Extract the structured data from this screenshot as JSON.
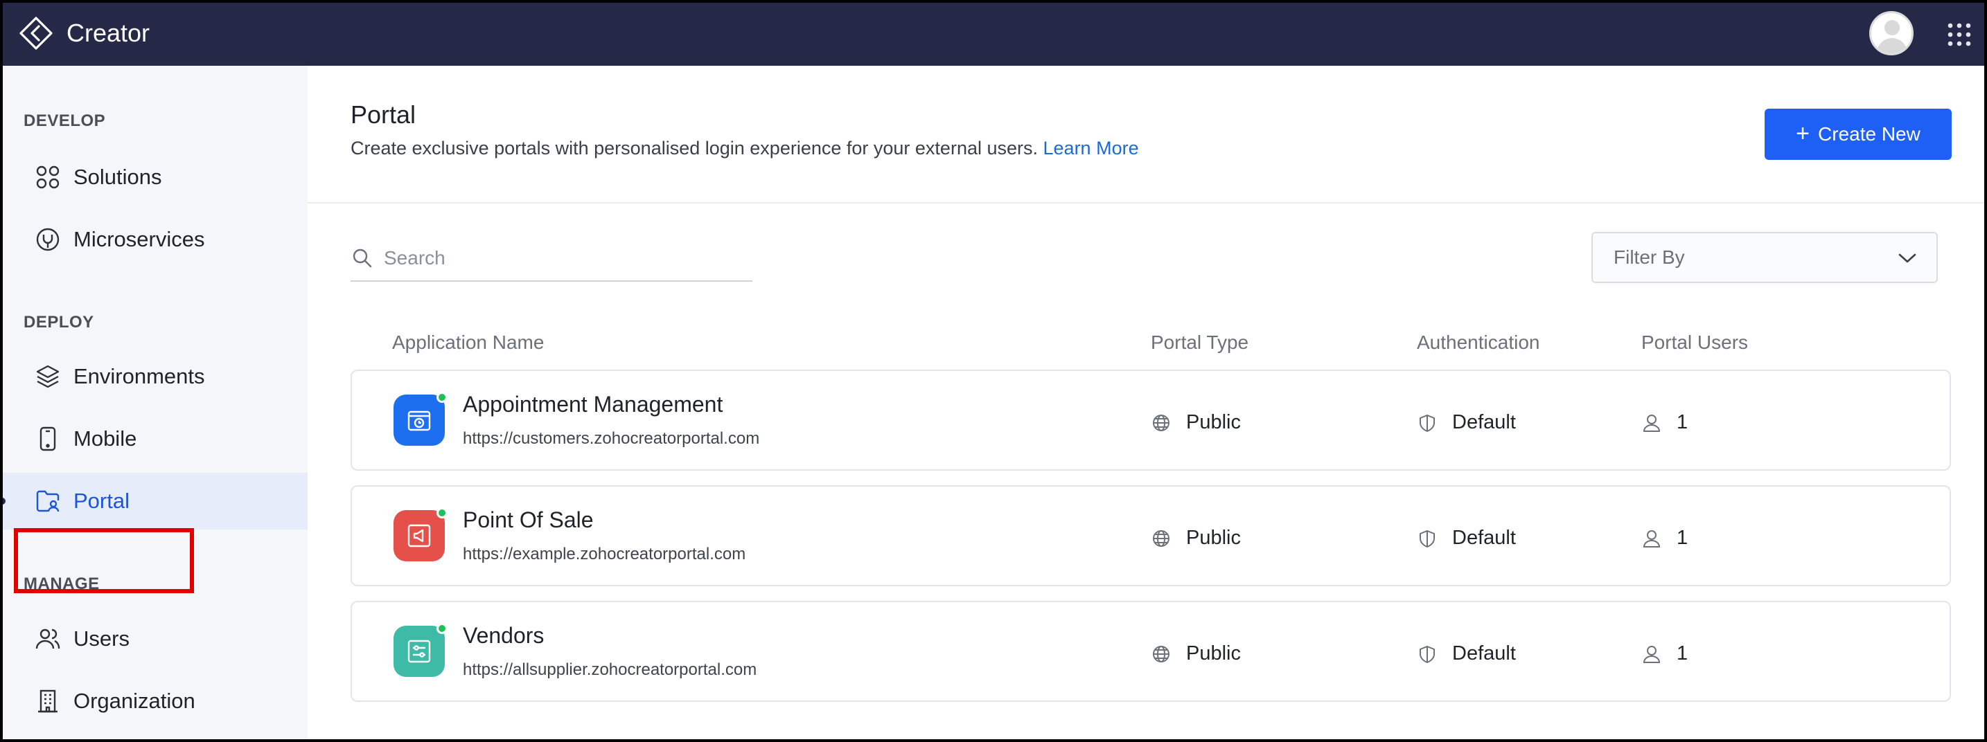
{
  "topbar": {
    "title": "Creator",
    "colors": {
      "background": "#262847",
      "text": "#ffffff"
    },
    "icons": [
      "creator-logo-icon",
      "user-avatar",
      "apps-grid-icon"
    ]
  },
  "sidebar": {
    "sections": [
      {
        "label": "DEVELOP",
        "items": [
          {
            "label": "Solutions",
            "icon": "solutions-icon"
          },
          {
            "label": "Microservices",
            "icon": "microservices-icon"
          }
        ]
      },
      {
        "label": "DEPLOY",
        "items": [
          {
            "label": "Environments",
            "icon": "layers-icon"
          },
          {
            "label": "Mobile",
            "icon": "mobile-icon"
          },
          {
            "label": "Portal",
            "icon": "portal-icon",
            "active": true
          }
        ]
      },
      {
        "label": "MANAGE",
        "items": [
          {
            "label": "Users",
            "icon": "users-icon"
          },
          {
            "label": "Organization",
            "icon": "organization-icon"
          }
        ]
      }
    ],
    "active_item": "Portal",
    "highlight_color": "#e00000"
  },
  "main": {
    "title": "Portal",
    "description": "Create exclusive portals with personalised login experience for your external users.",
    "learn_more": "Learn More",
    "create_button": "Create New",
    "search": {
      "placeholder": "Search",
      "value": ""
    },
    "filter": {
      "label": "Filter By"
    },
    "columns": [
      "Application Name",
      "Portal Type",
      "Authentication",
      "Portal Users"
    ],
    "rows": [
      {
        "name": "Appointment Management",
        "url": "https://customers.zohocreatorportal.com",
        "portal_type": "Public",
        "authentication": "Default",
        "users": "1",
        "icon_color": "#1e6ff0",
        "icon": "calendar-clock-icon",
        "status": "online"
      },
      {
        "name": "Point Of Sale",
        "url": "https://example.zohocreatorportal.com",
        "portal_type": "Public",
        "authentication": "Default",
        "users": "1",
        "icon_color": "#e5504a",
        "icon": "megaphone-icon",
        "status": "online"
      },
      {
        "name": "Vendors",
        "url": "https://allsupplier.zohocreatorportal.com",
        "portal_type": "Public",
        "authentication": "Default",
        "users": "1",
        "icon_color": "#3dbba6",
        "icon": "sliders-icon",
        "status": "online"
      }
    ],
    "accent_color": "#1e5ff5",
    "link_color": "#1b6ad4"
  }
}
